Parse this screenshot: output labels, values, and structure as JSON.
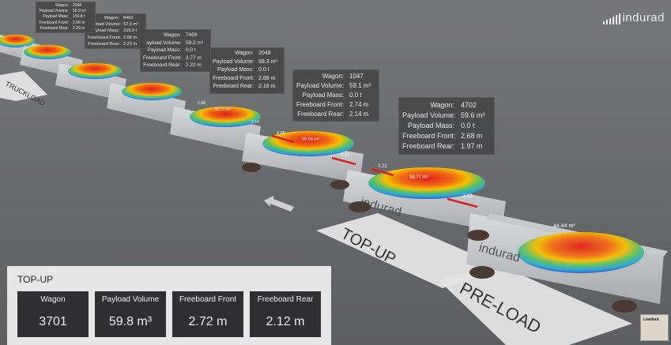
{
  "brand": {
    "logo_text": "indurad"
  },
  "scene": {
    "stations": {
      "topup": "TOP-UP",
      "preload": "PRE-LOAD",
      "far": "TRUCKLOAD"
    },
    "volume_labels": [
      "59.77 m³",
      "59.59 m³",
      "57.77 m³",
      "44.44 m³"
    ],
    "freeboard_labels": [
      "2.22",
      "2.12",
      "2.68",
      "1.97",
      "2.94",
      "2.14"
    ]
  },
  "wagons": [
    {
      "wagon_label": "Wagon:",
      "wagon": "4702",
      "volume_label": "Payload Volume:",
      "volume": "59.6 m³",
      "mass_label": "Payload Mass:",
      "mass": "0.0 t",
      "front_label": "Freeboard Front:",
      "front": "2.68 m",
      "rear_label": "Freeboard Rear:",
      "rear": "1.97 m"
    },
    {
      "wagon_label": "Wagon:",
      "wagon": "1047",
      "volume_label": "Payload Volume:",
      "volume": "59.1 m³",
      "mass_label": "Payload Mass:",
      "mass": "0.0 t",
      "front_label": "Freeboard Front:",
      "front": "2.74 m",
      "rear_label": "Freeboard Rear:",
      "rear": "2.14 m"
    },
    {
      "wagon_label": "Wagon:",
      "wagon": "2048",
      "volume_label": "Payload Volume:",
      "volume": "58.3 m³",
      "mass_label": "Payload Mass:",
      "mass": "0.0 t",
      "front_label": "Freeboard Front:",
      "front": "2.88 m",
      "rear_label": "Freeboard Rear:",
      "rear": "2.16 m"
    },
    {
      "wagon_label": "Wagon:",
      "wagon": "7459",
      "volume_label": "Payload Volume:",
      "volume": "58.2 m³",
      "mass_label": "Payload Mass:",
      "mass": "0.0 t",
      "front_label": "Freeboard Front:",
      "front": "2.77 m",
      "rear_label": "Freeboard Rear:",
      "rear": "2.22 m"
    },
    {
      "wagon_label": "Wagon:",
      "wagon": "8460",
      "volume_label": "Payload Volume:",
      "volume": "57.5 m³",
      "mass_label": "Payload Mass:",
      "mass": "159.9 t",
      "front_label": "Freeboard Front:",
      "front": "2.88 m",
      "rear_label": "Freeboard Rear:",
      "rear": "2.23 m"
    },
    {
      "wagon_label": "Wagon:",
      "wagon": "2048",
      "volume_label": "Payload Volume:",
      "volume": "56.9 m³",
      "mass_label": "Payload Mass:",
      "mass": "159.8 t",
      "front_label": "Freeboard Front:",
      "front": "2.96 m",
      "rear_label": "Freeboard Rear:",
      "rear": "2.29 m"
    }
  ],
  "panel": {
    "title": "TOP-UP",
    "cards": [
      {
        "label": "Wagon",
        "value": "3701"
      },
      {
        "label": "Payload Volume",
        "value": "59.8 m³"
      },
      {
        "label": "Freeboard Front",
        "value": "2.72 m"
      },
      {
        "label": "Freeboard Rear",
        "value": "2.12 m"
      }
    ]
  },
  "thumbnail": {
    "label": "Loadout"
  },
  "colors": {
    "background": "#6b6c6e",
    "panel": "#e7e7e7",
    "card": "#2f2f31",
    "heat_hot": "#e0201c",
    "heat_mid": "#f5c000",
    "heat_cool": "#29a7d8"
  }
}
